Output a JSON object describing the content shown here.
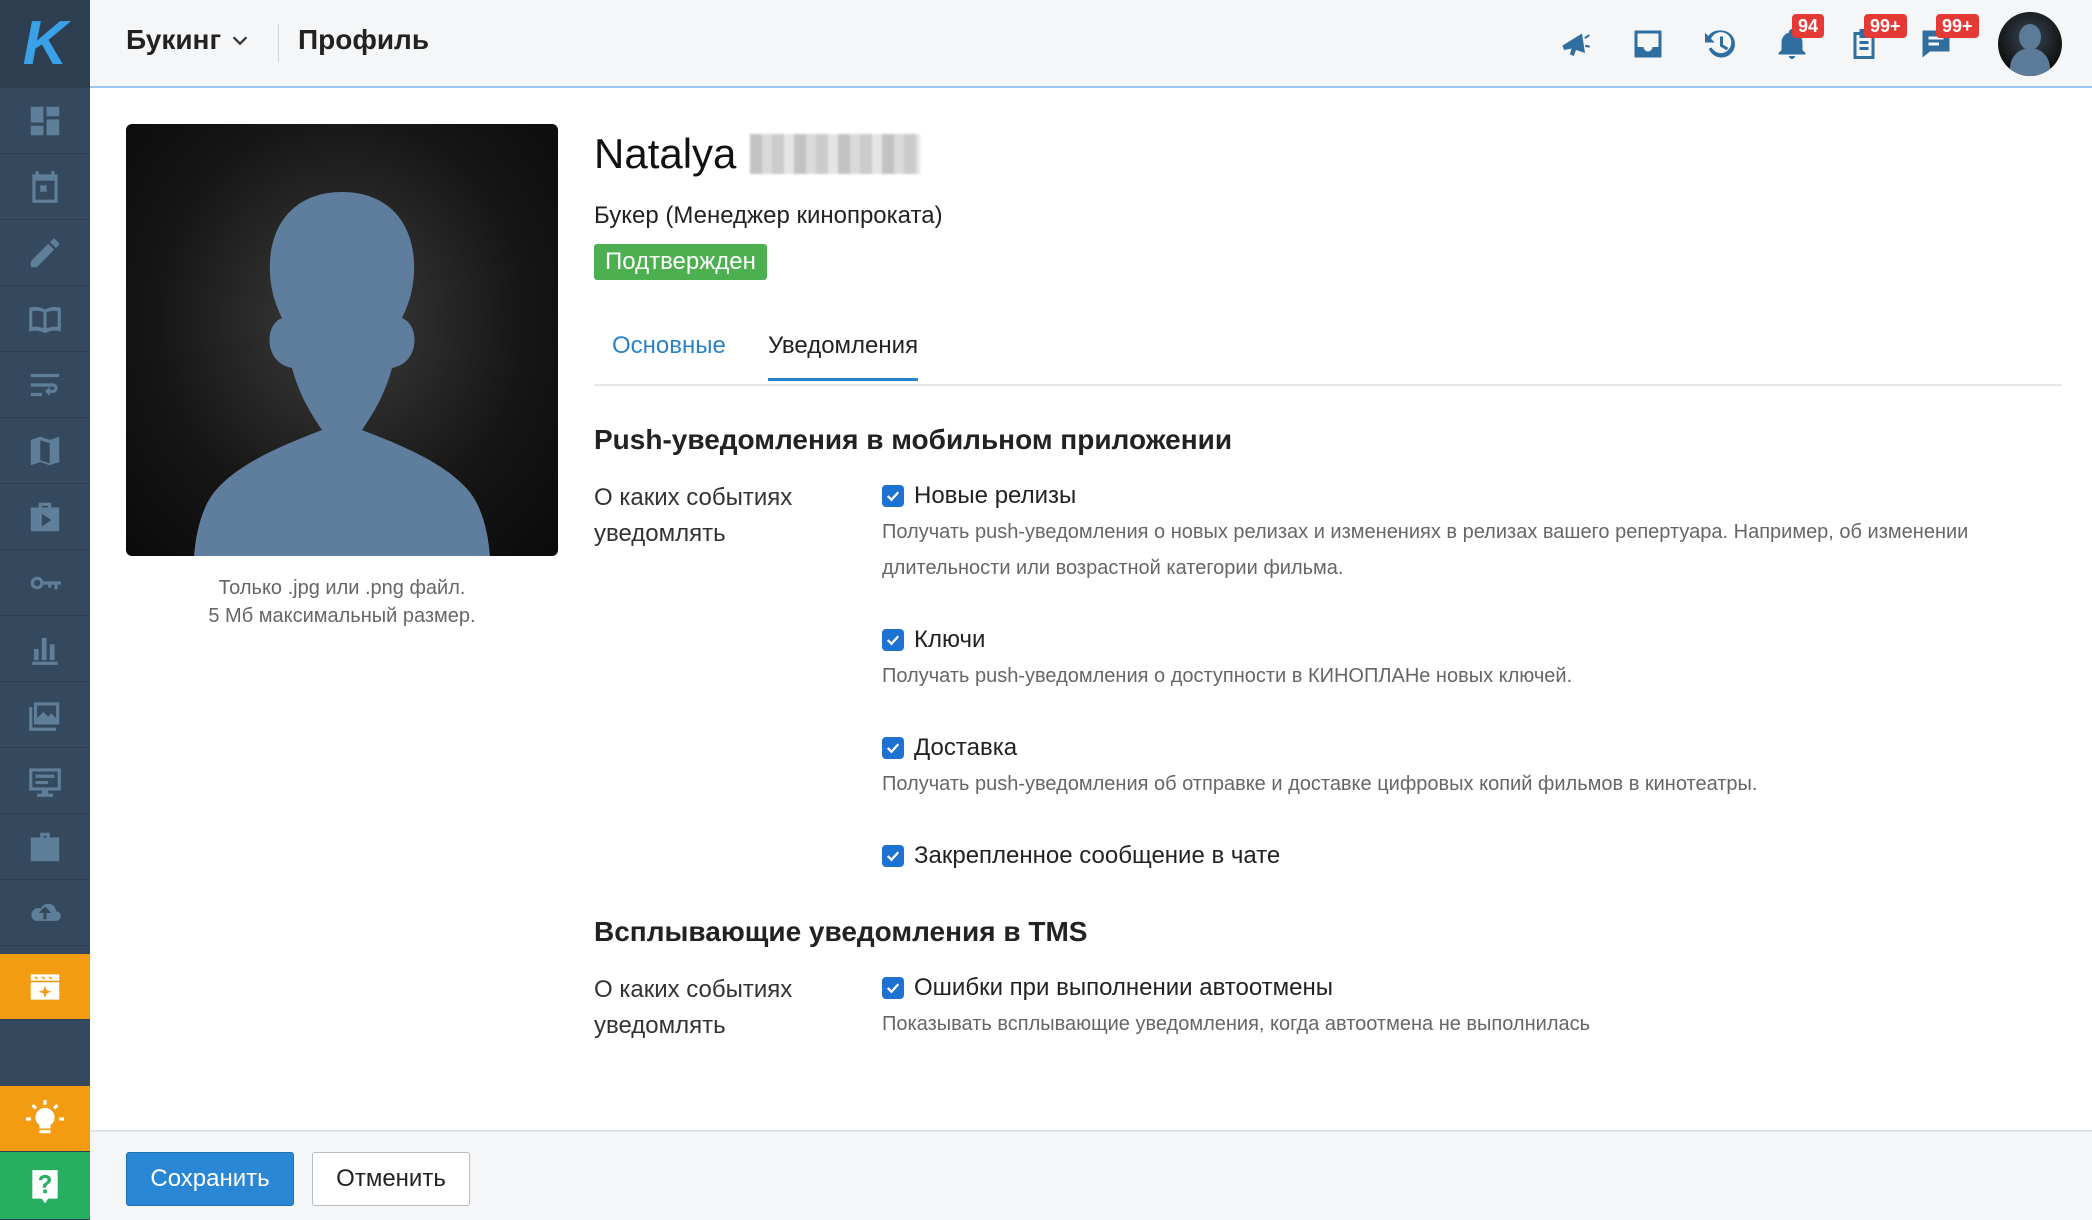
{
  "header": {
    "app_name": "Букинг",
    "page_title": "Профиль",
    "badges": {
      "notifications": "94",
      "tasks": "99+",
      "messages": "99+"
    }
  },
  "profile": {
    "first_name": "Natalya",
    "role": "Букер (Менеджер кинопроката)",
    "status": "Подтвержден",
    "photo_hint_line1": "Только .jpg или .png файл.",
    "photo_hint_line2": "5 Мб максимальный размер."
  },
  "tabs": [
    {
      "label": "Основные"
    },
    {
      "label": "Уведомления"
    }
  ],
  "sections": {
    "push": {
      "title": "Push-уведомления в мобильном приложении",
      "question": "О каких событиях уведомлять",
      "options": [
        {
          "label": "Новые релизы",
          "desc": "Получать push-уведомления о новых релизах и изменениях в релизах вашего репертуара. Например, об изменении длительности или возрастной категории фильма."
        },
        {
          "label": "Ключи",
          "desc": "Получать push-уведомления о доступности в КИНОПЛАНе новых ключей."
        },
        {
          "label": "Доставка",
          "desc": "Получать push-уведомления об отправке и доставке цифровых копий фильмов в кинотеатры."
        },
        {
          "label": "Закрепленное сообщение в чате",
          "desc": ""
        }
      ]
    },
    "tms": {
      "title": "Всплывающие уведомления в TMS",
      "question": "О каких событиях уведомлять",
      "options": [
        {
          "label": "Ошибки при выполнении автоотмены",
          "desc": "Показывать всплывающие уведомления, когда автоотмена не выполнилась"
        }
      ]
    }
  },
  "footer": {
    "save_label": "Сохранить",
    "cancel_label": "Отменить"
  },
  "colors": {
    "accent": "#2a87d6",
    "sidebar": "#34495e",
    "active_nav": "#f39c12",
    "status_green": "#4caf50",
    "badge_red": "#e53935"
  }
}
